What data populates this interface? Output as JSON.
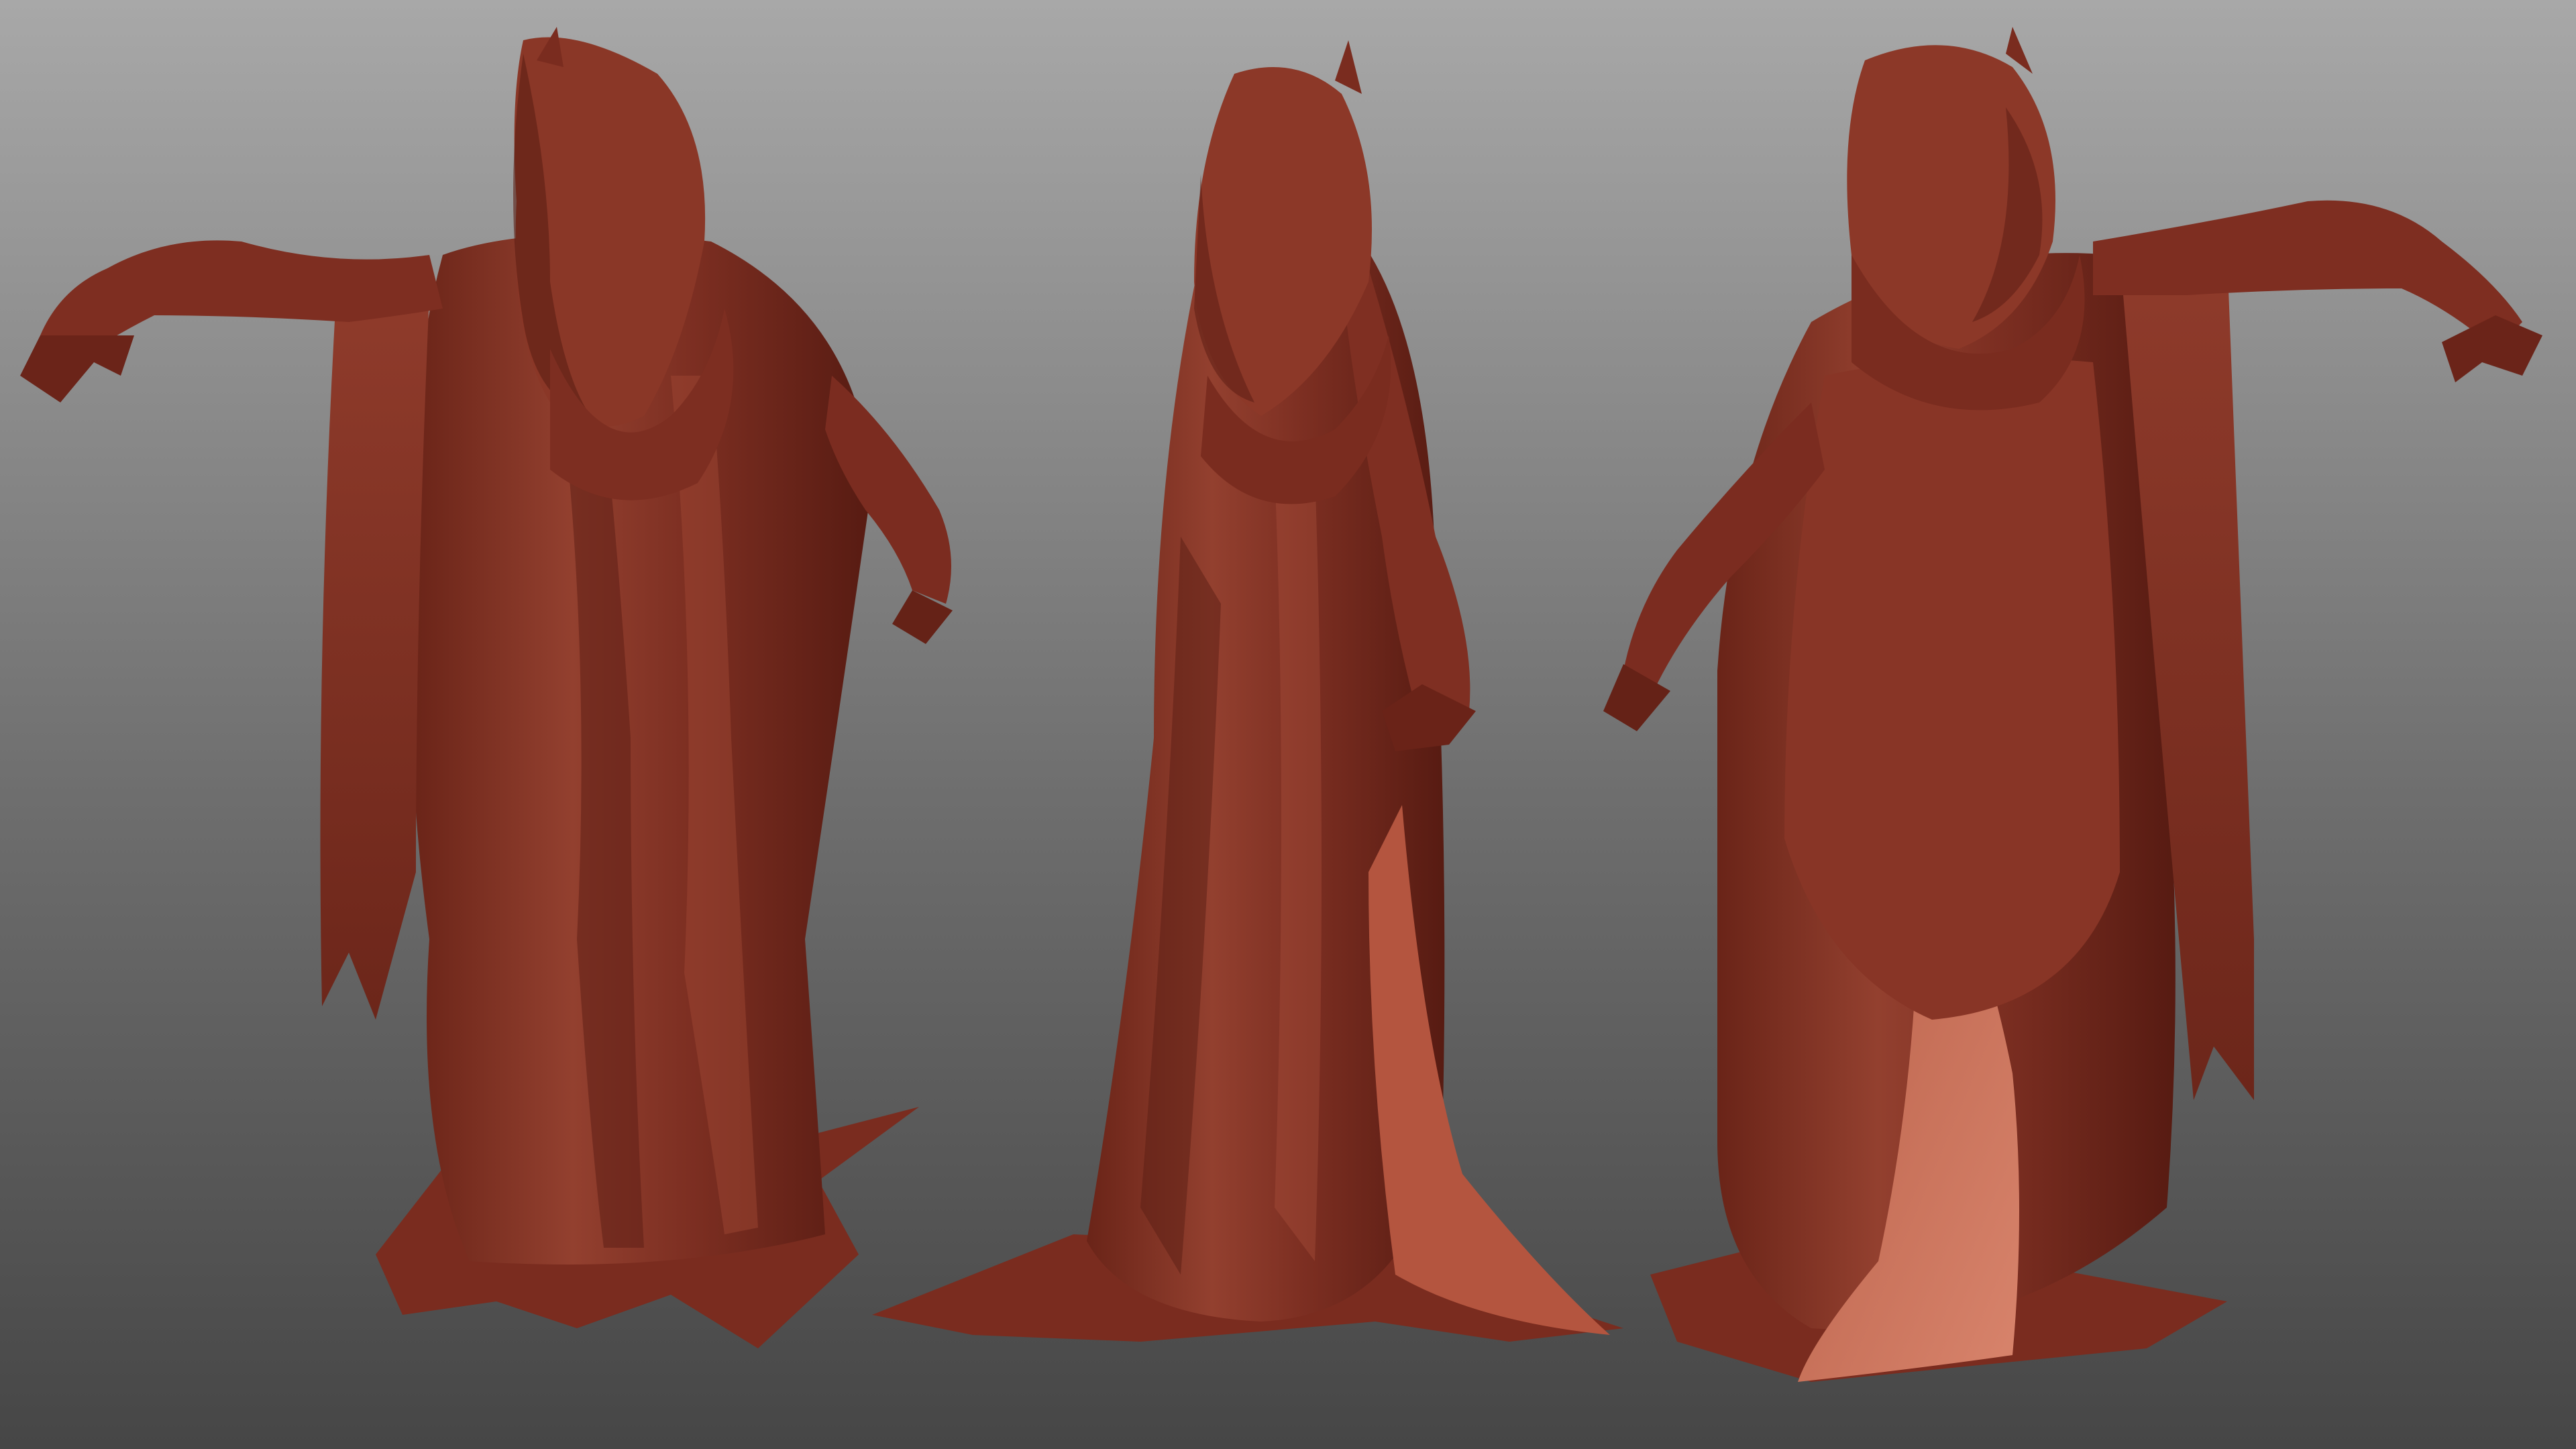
{
  "scene": {
    "description_visible_text": [],
    "background": {
      "top": "#a6a6a6",
      "bottom": "#4a4a4a"
    },
    "material": {
      "base": "#8c3526",
      "shadow": "#5a1d14",
      "highlight": "#c0604a",
      "inner_lining": "#c4705a"
    },
    "views": [
      {
        "name": "back-view"
      },
      {
        "name": "side-view"
      },
      {
        "name": "three-quarter-back-view"
      }
    ]
  }
}
